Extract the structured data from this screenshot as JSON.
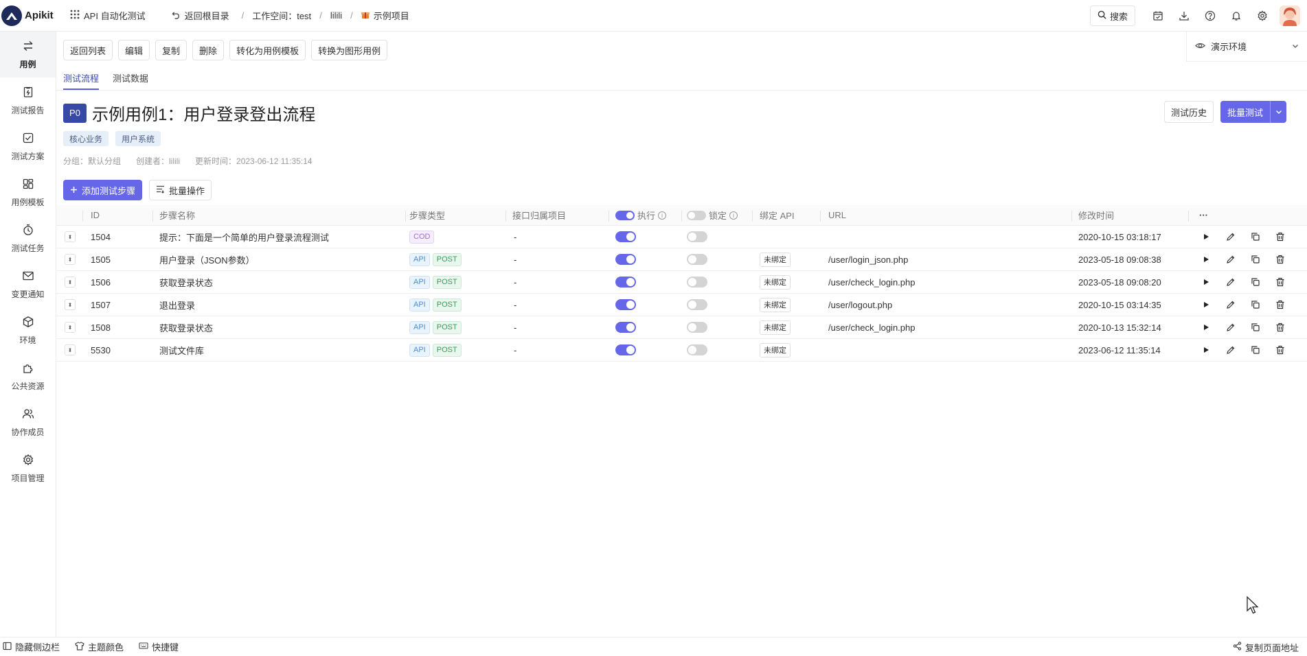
{
  "app": {
    "logo_text": "Apikit",
    "module_title": "API 自动化测试",
    "back_root": "返回根目录",
    "breadcrumb": {
      "workspace_label": "工作空间：test",
      "user": "lilili",
      "project": "示例项目"
    },
    "search_label": "搜索"
  },
  "sidebar": {
    "items": [
      {
        "label": "用例",
        "icon": "swap-icon"
      },
      {
        "label": "测试报告",
        "icon": "report-icon"
      },
      {
        "label": "测试方案",
        "icon": "checkbox-icon"
      },
      {
        "label": "用例模板",
        "icon": "template-icon"
      },
      {
        "label": "测试任务",
        "icon": "timer-icon"
      },
      {
        "label": "变更通知",
        "icon": "mail-icon"
      },
      {
        "label": "环境",
        "icon": "cube-icon"
      },
      {
        "label": "公共资源",
        "icon": "puzzle-icon"
      },
      {
        "label": "协作成员",
        "icon": "users-icon"
      },
      {
        "label": "项目管理",
        "icon": "gear-icon"
      }
    ]
  },
  "toolbar": {
    "back_list": "返回列表",
    "edit": "编辑",
    "copy": "复制",
    "delete": "删除",
    "to_template": "转化为用例模板",
    "to_graphic": "转换为图形用例"
  },
  "environment": {
    "label": "演示环境"
  },
  "tabs": {
    "flow": "测试流程",
    "data": "测试数据"
  },
  "case": {
    "priority": "P0",
    "title": "示例用例1：用户登录登出流程",
    "tags": [
      "核心业务",
      "用户系统"
    ],
    "meta": {
      "group": "分组：默认分组",
      "creator": "创建者：lilili",
      "updated": "更新时间：2023-06-12 11:35:14"
    },
    "history_button": "测试历史",
    "batch_test_button": "批量测试"
  },
  "actions": {
    "add_step": "添加测试步骤",
    "batch_ops": "批量操作"
  },
  "table": {
    "headers": {
      "id": "ID",
      "name": "步骤名称",
      "type": "步骤类型",
      "project": "接口归属项目",
      "exec": "执行",
      "lock": "锁定",
      "bind": "绑定 API",
      "url": "URL",
      "time": "修改时间",
      "more": "···"
    },
    "rows": [
      {
        "id": "1504",
        "name": "提示：下面是一个简单的用户登录流程测试",
        "badges": [
          "COD"
        ],
        "project": "-",
        "exec": true,
        "lock": false,
        "bind": "",
        "url": "",
        "time": "2020-10-15 03:18:17"
      },
      {
        "id": "1505",
        "name": "用户登录（JSON参数）",
        "badges": [
          "API",
          "POST"
        ],
        "project": "-",
        "exec": true,
        "lock": false,
        "bind": "未绑定",
        "url": "/user/login_json.php",
        "time": "2023-05-18 09:08:38"
      },
      {
        "id": "1506",
        "name": "获取登录状态",
        "badges": [
          "API",
          "POST"
        ],
        "project": "-",
        "exec": true,
        "lock": false,
        "bind": "未绑定",
        "url": "/user/check_login.php",
        "time": "2023-05-18 09:08:20"
      },
      {
        "id": "1507",
        "name": "退出登录",
        "badges": [
          "API",
          "POST"
        ],
        "project": "-",
        "exec": true,
        "lock": false,
        "bind": "未绑定",
        "url": "/user/logout.php",
        "time": "2020-10-15 03:14:35"
      },
      {
        "id": "1508",
        "name": "获取登录状态",
        "badges": [
          "API",
          "POST"
        ],
        "project": "-",
        "exec": true,
        "lock": false,
        "bind": "未绑定",
        "url": "/user/check_login.php",
        "time": "2020-10-13 15:32:14"
      },
      {
        "id": "5530",
        "name": "测试文件库",
        "badges": [
          "API",
          "POST"
        ],
        "project": "-",
        "exec": true,
        "lock": false,
        "bind": "未绑定",
        "url": "",
        "time": "2023-06-12 11:35:14"
      }
    ]
  },
  "bottombar": {
    "hide_sidebar": "隐藏侧边栏",
    "theme": "主题颜色",
    "shortcuts": "快捷键",
    "copy_url": "复制页面地址"
  },
  "colors": {
    "accent": "#6567e8",
    "priority": "#3748a6"
  }
}
